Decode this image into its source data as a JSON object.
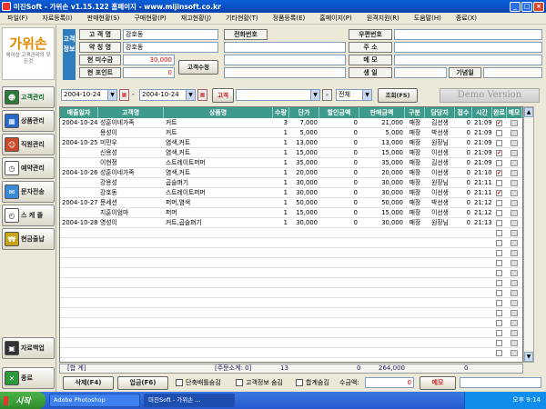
{
  "window": {
    "title": "미진Soft - 가위손 v1.15.122 홈페이지 - www.mijinsoft.co.kr"
  },
  "menu": [
    "파일(F)",
    "자료등록(I)",
    "판매현황(S)",
    "구매현황(P)",
    "재고현황(J)",
    "기타현황(T)",
    "정품등록(E)",
    "홈페이지(P)",
    "원격지원(R)",
    "도움말(H)",
    "종료(X)"
  ],
  "logo": {
    "brand": "가위손",
    "tagline": "헤어샵 고객관리의 모든것"
  },
  "sidebar": [
    {
      "label": "고객관리",
      "icon": "people-icon",
      "color": "#2d7a3a"
    },
    {
      "label": "상품관리",
      "icon": "products-icon",
      "color": "#2a68c8"
    },
    {
      "label": "직원관리",
      "icon": "staff-icon",
      "color": "#c84a2a"
    },
    {
      "label": "예약관리",
      "icon": "clock-icon",
      "color": "#6a6a6a"
    },
    {
      "label": "문자전송",
      "icon": "phone-icon",
      "color": "#3a8ad8"
    },
    {
      "label": "스 케 줄",
      "icon": "clock-icon",
      "color": "#777777"
    },
    {
      "label": "현금출납",
      "icon": "won-icon",
      "color": "#c8a21a"
    },
    {
      "label": "자료백업",
      "icon": "disk-icon",
      "color": "#333333"
    },
    {
      "label": "종료",
      "icon": "exit-icon",
      "color": "#2a9a3a"
    }
  ],
  "customer": {
    "section_label": "고객정보",
    "labels": {
      "name": "고 객 명",
      "short_name": "약 칭 명",
      "unpaid": "현 미수금",
      "points": "현 포인트",
      "phone": "전화번호",
      "zip": "우편번호",
      "address": "주   소",
      "memo": "메   모",
      "birthday": "생   일",
      "anniversary": "기념일"
    },
    "values": {
      "name": "강호동",
      "short_name": "강호동",
      "unpaid": "30,000",
      "points": "0"
    },
    "edit_button": "고객수정"
  },
  "filter": {
    "date_from": "2004-10-24",
    "date_to": "2004-10-24",
    "customer_label": "고객",
    "type_value": "전체",
    "search_button": "조회(F5)",
    "demo": "Demo Version"
  },
  "table": {
    "headers": [
      "매출일자",
      "고객명",
      "상품명",
      "수량",
      "단가",
      "할인금액",
      "판매금액",
      "구분",
      "담당자",
      "접수",
      "시간",
      "완료",
      "메모"
    ],
    "rows": [
      [
        "2004-10-24",
        "성훈이네가족",
        "커트",
        "3",
        "7,000",
        "0",
        "21,000",
        "매장",
        "김선생",
        "0",
        "21:09",
        true
      ],
      [
        "",
        "용성이",
        "커트",
        "1",
        "5,000",
        "0",
        "5,000",
        "매장",
        "박선생",
        "0",
        "21:09",
        false
      ],
      [
        "2004-10-25",
        "미민우",
        "염색,커트",
        "1",
        "13,000",
        "0",
        "13,000",
        "매장",
        "원장님",
        "0",
        "21:09",
        false
      ],
      [
        "",
        "신용성",
        "염색,커트",
        "1",
        "15,000",
        "0",
        "15,000",
        "매장",
        "이선생",
        "0",
        "21:09",
        true
      ],
      [
        "",
        "이현정",
        "스트레이트퍼머",
        "1",
        "35,000",
        "0",
        "35,000",
        "매장",
        "김선생",
        "0",
        "21:09",
        false
      ],
      [
        "2004-10-26",
        "성훈이네가족",
        "염색,커트",
        "1",
        "20,000",
        "0",
        "20,000",
        "매장",
        "이선생",
        "0",
        "21:10",
        true
      ],
      [
        "",
        "강용성",
        "곱슬펴기",
        "1",
        "30,000",
        "0",
        "30,000",
        "매장",
        "원장님",
        "0",
        "21:11",
        false
      ],
      [
        "",
        "강호동",
        "스트레이트퍼머",
        "1",
        "30,000",
        "0",
        "30,000",
        "매장",
        "이선생",
        "0",
        "21:11",
        true
      ],
      [
        "2004-10-27",
        "문세션",
        "퍼머,염색",
        "1",
        "50,000",
        "0",
        "50,000",
        "매장",
        "박선생",
        "0",
        "21:12",
        false
      ],
      [
        "",
        "지훈이엄마",
        "퍼머",
        "1",
        "15,000",
        "0",
        "15,000",
        "매장",
        "이선생",
        "0",
        "21:12",
        false
      ],
      [
        "2004-10-28",
        "영성이",
        "커트,곱슬펴기",
        "1",
        "30,000",
        "0",
        "30,000",
        "매장",
        "원장님",
        "0",
        "21:13",
        false
      ]
    ]
  },
  "totals": {
    "label": "[합 계]",
    "order_count": "[주문소계: 0]",
    "qty": "13",
    "discount": "0",
    "amount": "264,000",
    "receipt": "0"
  },
  "bottom": {
    "delete_button": "삭제(F4)",
    "update_button": "업금(F6)",
    "chk_separate": "단축배틀숨김",
    "chk_info": "고객정보 숨김",
    "chk_sum": "합계숨김",
    "amount_label": "수금액:",
    "amount_value": "0",
    "memo_button": "메모"
  },
  "taskbar": {
    "start": "시작",
    "tasks": [
      "Adobe Photoshop",
      "미진Soft - 가위손 ..."
    ],
    "clock": "오후 9:14"
  }
}
